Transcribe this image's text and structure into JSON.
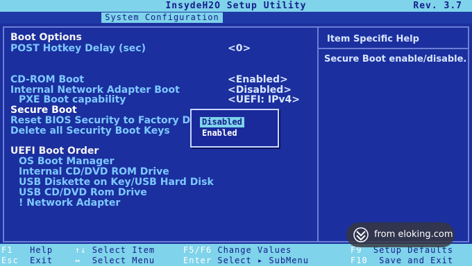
{
  "header": {
    "title": "InsydeH2O Setup Utility",
    "revision": "Rev.  3.7",
    "active_tab": "System Configuration"
  },
  "menu": {
    "boot_options_heading": "Boot Options",
    "post_hotkey_label": "POST Hotkey Delay (sec)",
    "post_hotkey_value": "<0>",
    "cdrom_boot_label": "CD-ROM Boot",
    "cdrom_boot_value": "<Enabled>",
    "network_boot_label": "Internal Network Adapter Boot",
    "network_boot_value": "<Disabled>",
    "pxe_label": "PXE Boot capability",
    "pxe_value": "<UEFI: IPv4>",
    "secure_boot_label": "Secure Boot",
    "reset_bios_label": "Reset BIOS Security to Factory Defau",
    "delete_keys_label": "Delete all Security Boot Keys",
    "uefi_order_heading": "UEFI Boot Order",
    "boot_order": [
      "OS Boot Manager",
      "Internal CD/DVD ROM Drive",
      "USB Diskette on Key/USB Hard Disk",
      "USB CD/DVD Rom Drive",
      "! Network Adapter"
    ]
  },
  "popup": {
    "options": [
      "Disabled",
      "Enabled"
    ],
    "highlighted": "Disabled"
  },
  "help": {
    "title": "Item Specific Help",
    "text": "Secure Boot enable/disable."
  },
  "footer": {
    "row1": [
      {
        "key": "F1",
        "label": "Help"
      },
      {
        "key": "↑↓",
        "label": "Select Item"
      },
      {
        "key": "F5/F6",
        "label": "Change Values"
      },
      {
        "key": "F9",
        "label": "Setup Defaults"
      }
    ],
    "row2": [
      {
        "key": "Esc",
        "label": "Exit"
      },
      {
        "key": "↔",
        "label": "Select Menu"
      },
      {
        "key": "Enter",
        "label": "Select ▸ SubMenu"
      },
      {
        "key": "F10",
        "label": "Save and Exit"
      }
    ]
  },
  "watermark": {
    "text": "from eloking.com"
  },
  "colors": {
    "background": "#1b2f9e",
    "accent_bar": "#7fd3ea",
    "item_text": "#7ec8ff",
    "value_text": "#d8e6ff"
  }
}
